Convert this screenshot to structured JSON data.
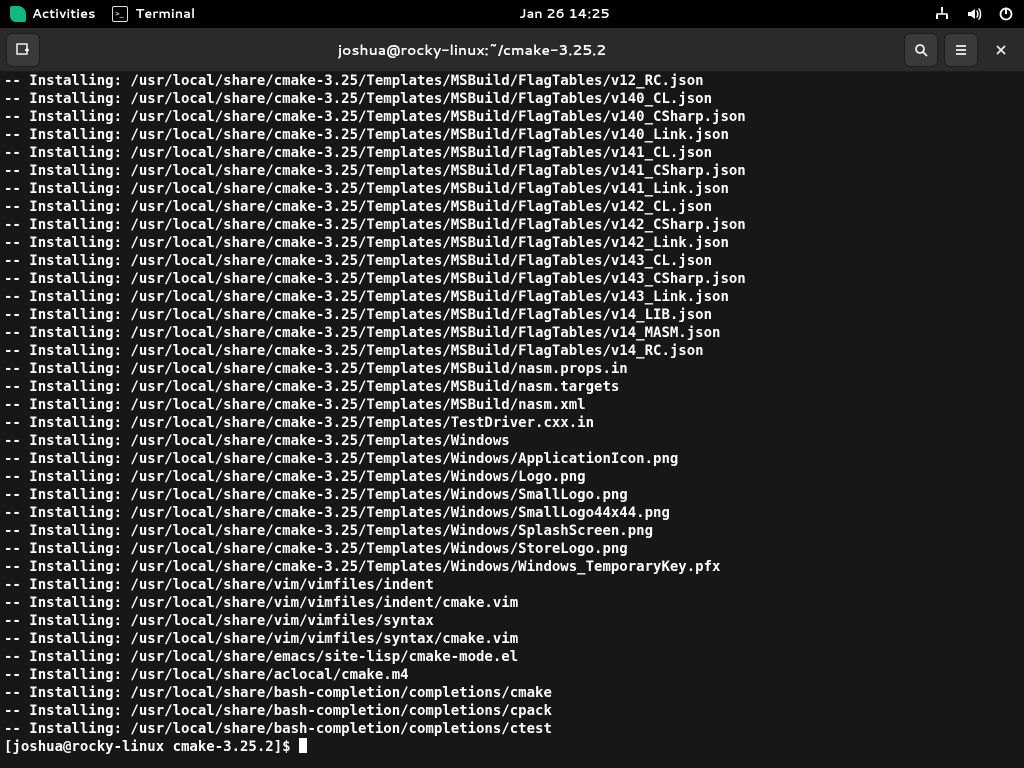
{
  "panel": {
    "activities": "Activities",
    "app_name": "Terminal",
    "clock": "Jan 26  14:25"
  },
  "window": {
    "title": "joshua@rocky-linux:~/cmake-3.25.2"
  },
  "terminal": {
    "install_prefix": "-- Installing: ",
    "paths": [
      "/usr/local/share/cmake-3.25/Templates/MSBuild/FlagTables/v12_RC.json",
      "/usr/local/share/cmake-3.25/Templates/MSBuild/FlagTables/v140_CL.json",
      "/usr/local/share/cmake-3.25/Templates/MSBuild/FlagTables/v140_CSharp.json",
      "/usr/local/share/cmake-3.25/Templates/MSBuild/FlagTables/v140_Link.json",
      "/usr/local/share/cmake-3.25/Templates/MSBuild/FlagTables/v141_CL.json",
      "/usr/local/share/cmake-3.25/Templates/MSBuild/FlagTables/v141_CSharp.json",
      "/usr/local/share/cmake-3.25/Templates/MSBuild/FlagTables/v141_Link.json",
      "/usr/local/share/cmake-3.25/Templates/MSBuild/FlagTables/v142_CL.json",
      "/usr/local/share/cmake-3.25/Templates/MSBuild/FlagTables/v142_CSharp.json",
      "/usr/local/share/cmake-3.25/Templates/MSBuild/FlagTables/v142_Link.json",
      "/usr/local/share/cmake-3.25/Templates/MSBuild/FlagTables/v143_CL.json",
      "/usr/local/share/cmake-3.25/Templates/MSBuild/FlagTables/v143_CSharp.json",
      "/usr/local/share/cmake-3.25/Templates/MSBuild/FlagTables/v143_Link.json",
      "/usr/local/share/cmake-3.25/Templates/MSBuild/FlagTables/v14_LIB.json",
      "/usr/local/share/cmake-3.25/Templates/MSBuild/FlagTables/v14_MASM.json",
      "/usr/local/share/cmake-3.25/Templates/MSBuild/FlagTables/v14_RC.json",
      "/usr/local/share/cmake-3.25/Templates/MSBuild/nasm.props.in",
      "/usr/local/share/cmake-3.25/Templates/MSBuild/nasm.targets",
      "/usr/local/share/cmake-3.25/Templates/MSBuild/nasm.xml",
      "/usr/local/share/cmake-3.25/Templates/TestDriver.cxx.in",
      "/usr/local/share/cmake-3.25/Templates/Windows",
      "/usr/local/share/cmake-3.25/Templates/Windows/ApplicationIcon.png",
      "/usr/local/share/cmake-3.25/Templates/Windows/Logo.png",
      "/usr/local/share/cmake-3.25/Templates/Windows/SmallLogo.png",
      "/usr/local/share/cmake-3.25/Templates/Windows/SmallLogo44x44.png",
      "/usr/local/share/cmake-3.25/Templates/Windows/SplashScreen.png",
      "/usr/local/share/cmake-3.25/Templates/Windows/StoreLogo.png",
      "/usr/local/share/cmake-3.25/Templates/Windows/Windows_TemporaryKey.pfx",
      "/usr/local/share/vim/vimfiles/indent",
      "/usr/local/share/vim/vimfiles/indent/cmake.vim",
      "/usr/local/share/vim/vimfiles/syntax",
      "/usr/local/share/vim/vimfiles/syntax/cmake.vim",
      "/usr/local/share/emacs/site-lisp/cmake-mode.el",
      "/usr/local/share/aclocal/cmake.m4",
      "/usr/local/share/bash-completion/completions/cmake",
      "/usr/local/share/bash-completion/completions/cpack",
      "/usr/local/share/bash-completion/completions/ctest"
    ],
    "prompt": "[joshua@rocky-linux cmake-3.25.2]$ "
  }
}
